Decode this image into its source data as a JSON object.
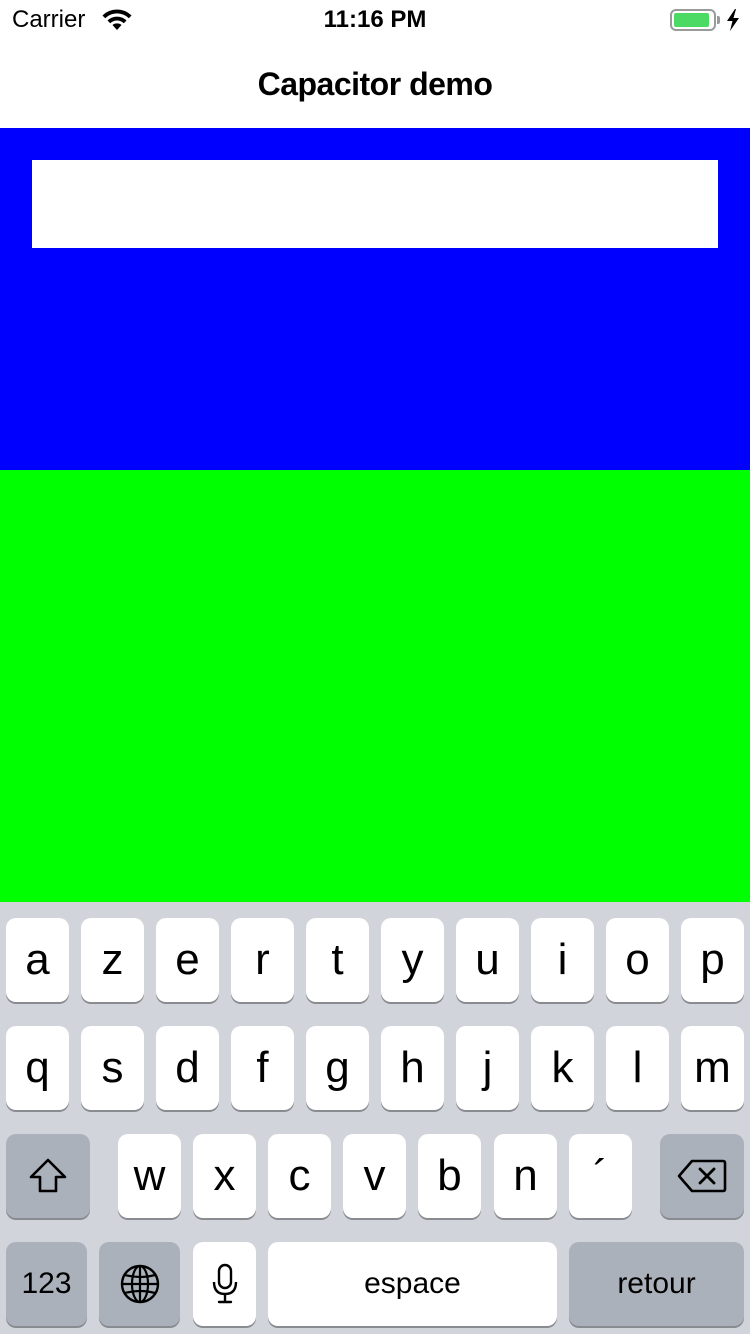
{
  "status_bar": {
    "carrier": "Carrier",
    "time": "11:16 PM",
    "battery_level": 0.92,
    "battery_color": "#4cd964",
    "icons": [
      "wifi-icon",
      "battery-icon",
      "charging-bolt-icon"
    ]
  },
  "nav": {
    "title": "Capacitor demo"
  },
  "content": {
    "top_panel_color": "#0000ff",
    "bottom_panel_color": "#00ff00",
    "input": {
      "value": "",
      "placeholder": ""
    }
  },
  "keyboard": {
    "row1": [
      "a",
      "z",
      "e",
      "r",
      "t",
      "y",
      "u",
      "i",
      "o",
      "p"
    ],
    "row2": [
      "q",
      "s",
      "d",
      "f",
      "g",
      "h",
      "j",
      "k",
      "l",
      "m"
    ],
    "row3": [
      "w",
      "x",
      "c",
      "v",
      "b",
      "n",
      "´"
    ],
    "numbers_label": "123",
    "space_label": "espace",
    "return_label": "retour",
    "icons": [
      "shift-icon",
      "backspace-icon",
      "globe-icon",
      "microphone-icon"
    ]
  }
}
